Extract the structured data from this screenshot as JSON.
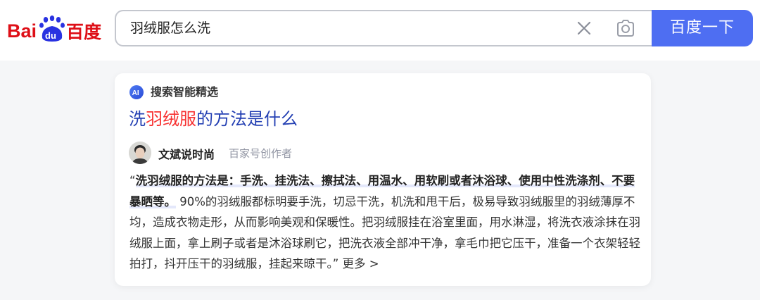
{
  "header": {
    "logo": {
      "text_bai": "Bai",
      "text_du": "du",
      "text_cn": "百度",
      "brand_red": "#de0f17",
      "brand_blue": "#2932e1"
    },
    "search": {
      "value": "羽绒服怎么洗"
    },
    "search_button_label": "百度一下",
    "accent": "#4e6ef2"
  },
  "card": {
    "ai_label": "搜索智能精选",
    "title": {
      "pre": "洗",
      "highlight": "羽绒服",
      "post": "的方法是什么"
    },
    "author": {
      "name": "文斌说时尚",
      "tag": "百家号创作者"
    },
    "content": {
      "open_quote": "“",
      "bold": "洗羽绒服的方法是：手洗、挂洗法、擦拭法、用温水、用软刷或者沐浴球、使用中性洗涤剂、不要暴晒等。",
      "rest": " 90%的羽绒服都标明要手洗，切忌干洗，机洗和甩干后，极易导致羽绒服里的羽绒薄厚不均，造成衣物走形，从而影响美观和保暖性。把羽绒服挂在浴室里面，用水淋湿，将洗衣液涂抹在羽绒服上面，拿上刷子或者是沐浴球刷它，把洗衣液全部冲干净，拿毛巾把它压干，准备一个衣架轻轻拍打，抖开压干的羽绒服，挂起来晾干。",
      "close_quote": "” ",
      "more": "更多 >"
    }
  }
}
